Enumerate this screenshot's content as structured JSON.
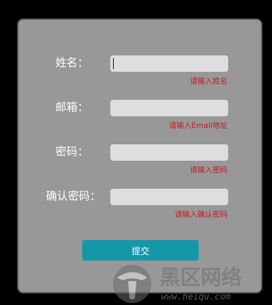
{
  "form": {
    "fields": [
      {
        "label": "姓名：",
        "value": "",
        "hint": "请输入姓名"
      },
      {
        "label": "邮箱：",
        "value": "",
        "hint": "请输入Email地址"
      },
      {
        "label": "密码：",
        "value": "",
        "hint": "请输入密码"
      },
      {
        "label": "确认密码：",
        "value": "",
        "hint": "请输入确认密码"
      }
    ],
    "submit_label": "提交"
  },
  "watermark": {
    "title": "黑区网络",
    "url": "www.heiqu.com"
  },
  "colors": {
    "page_background": "#000000",
    "panel_background": "#989898",
    "input_background": "#dedede",
    "hint_text": "#c8191e",
    "button_background": "#1498a8"
  }
}
